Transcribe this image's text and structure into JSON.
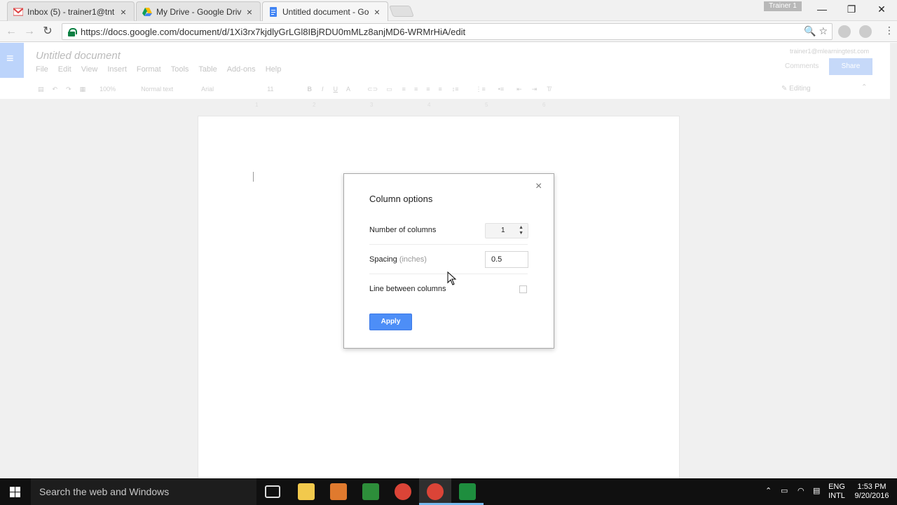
{
  "browser": {
    "tabs": [
      {
        "label": "Inbox (5) - trainer1@tnt",
        "favicon": "gmail-icon",
        "active": false
      },
      {
        "label": "My Drive - Google Drive",
        "favicon": "drive-icon",
        "active": false
      },
      {
        "label": "Untitled document - Goo",
        "favicon": "docs-icon",
        "active": true
      }
    ],
    "profile": "Trainer 1",
    "url": "https://docs.google.com/document/d/1Xi3rx7kjdlyGrLGl8IBjRDU0mMLz8anjMD6-WRMrHiA/edit"
  },
  "docs": {
    "title": "Untitled document",
    "menus": [
      "File",
      "Edit",
      "View",
      "Insert",
      "Format",
      "Tools",
      "Table",
      "Add-ons",
      "Help"
    ],
    "user_email": "trainer1@mlearningtest.com",
    "comments_label": "Comments",
    "share_label": "Share",
    "zoom": "100%",
    "style": "Normal text",
    "font": "Arial",
    "font_size": "11",
    "mode": "Editing",
    "ruler": [
      "1",
      "2",
      "3",
      "4",
      "5",
      "6"
    ]
  },
  "dialog": {
    "title": "Column options",
    "num_columns_label": "Number of columns",
    "num_columns_value": "1",
    "spacing_label": "Spacing",
    "spacing_hint": "(inches)",
    "spacing_value": "0.5",
    "line_between_label": "Line between columns",
    "line_between_checked": false,
    "apply_label": "Apply"
  },
  "taskbar": {
    "search_placeholder": "Search the web and Windows",
    "lang_top": "ENG",
    "lang_bottom": "INTL",
    "time": "1:53 PM",
    "date": "9/20/2016"
  }
}
